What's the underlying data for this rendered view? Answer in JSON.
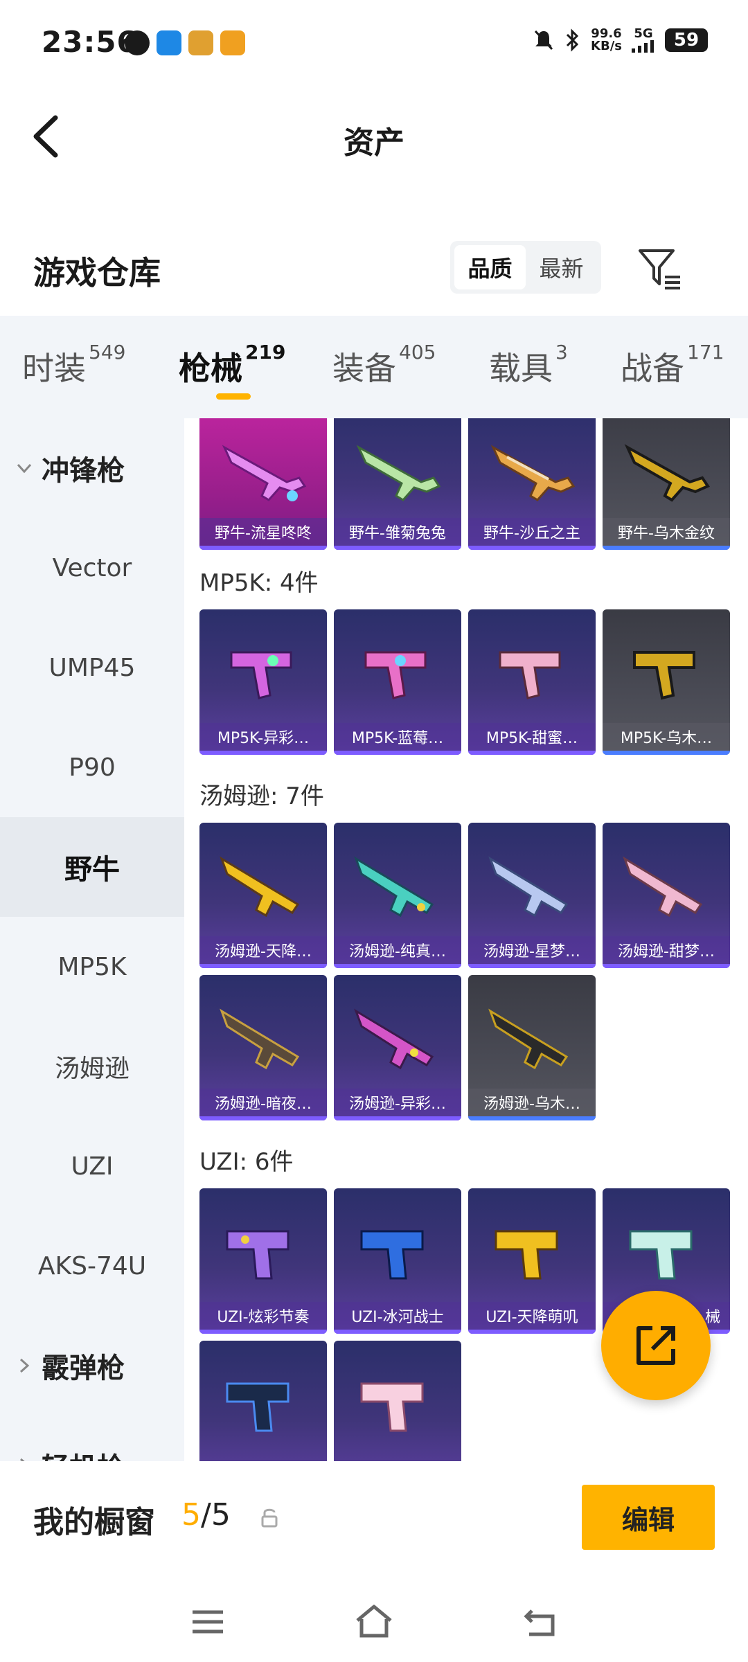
{
  "status_bar": {
    "time": "23:56",
    "net_speed_value": "99.6",
    "net_speed_unit": "KB/s",
    "network": "5G",
    "battery": "59"
  },
  "header": {
    "title": "资产"
  },
  "warehouse": {
    "title": "游戏仓库",
    "sort_options": [
      "品质",
      "最新"
    ],
    "sort_selected": "品质"
  },
  "tabs": [
    {
      "label": "时装",
      "count": "549"
    },
    {
      "label": "枪械",
      "count": "219",
      "active": true
    },
    {
      "label": "装备",
      "count": "405"
    },
    {
      "label": "载具",
      "count": "3"
    },
    {
      "label": "战备",
      "count": "171"
    }
  ],
  "sidebar": {
    "category_expanded": "冲锋枪",
    "items": [
      "Vector",
      "UMP45",
      "P90",
      "野牛",
      "MP5K",
      "汤姆逊",
      "UZI",
      "AKS-74U"
    ],
    "selected": "野牛",
    "category_collapsed": "霰弹枪",
    "category_partial": "轻机枪"
  },
  "groups": {
    "bison": {
      "items": [
        "野牛-流星咚咚",
        "野牛-雏菊兔兔",
        "野牛-沙丘之主",
        "野牛-乌木金纹"
      ]
    },
    "mp5k": {
      "title": "MP5K: 4件",
      "items": [
        "MP5K-异彩…",
        "MP5K-蓝莓…",
        "MP5K-甜蜜…",
        "MP5K-乌木…"
      ]
    },
    "thompson": {
      "title": "汤姆逊: 7件",
      "items": [
        "汤姆逊-天降…",
        "汤姆逊-纯真…",
        "汤姆逊-星梦…",
        "汤姆逊-甜梦…",
        "汤姆逊-暗夜…",
        "汤姆逊-异彩…",
        "汤姆逊-乌木…"
      ]
    },
    "uzi": {
      "title": "UZI: 6件",
      "items": [
        "UZI-炫彩节奏",
        "UZI-冰河战士",
        "UZI-天降萌叽",
        "械"
      ]
    }
  },
  "showcase": {
    "label": "我的橱窗",
    "current": "5",
    "total": "/5",
    "edit_label": "编辑"
  },
  "colors": {
    "accent": "#ffad00",
    "card_purple": "#40357a",
    "card_gold_tier": "#4a4b55",
    "card_legendary": "#c025a0"
  }
}
